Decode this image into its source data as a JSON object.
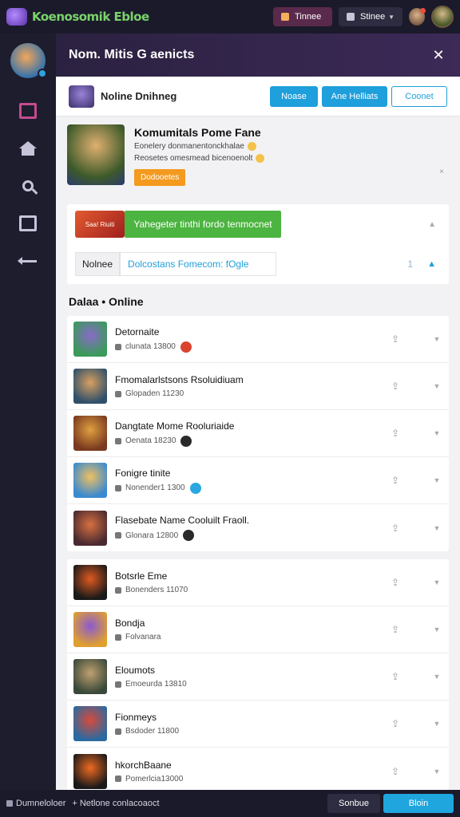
{
  "app": {
    "logo_text": "Koenosomik Ebloe",
    "top_buttons": {
      "coins_label": "Tinnee",
      "status_label": "Stinee"
    }
  },
  "sidebar": {
    "items": [
      {
        "name": "sidebar-item-library",
        "icon": "library-icon",
        "active": true
      },
      {
        "name": "sidebar-item-home",
        "icon": "home-icon",
        "active": false
      },
      {
        "name": "sidebar-item-search",
        "icon": "search-icon",
        "active": false
      },
      {
        "name": "sidebar-item-exit",
        "icon": "exit-icon",
        "active": false
      },
      {
        "name": "sidebar-item-back",
        "icon": "back-arrow-icon",
        "active": false
      }
    ]
  },
  "modal": {
    "title": "Nom. Mitis G aenicts",
    "close_glyph": "✕",
    "toolbar": {
      "label": "Noline Dnihneg",
      "buttons": [
        "Noase",
        "Ane Helliats",
        "Coonet"
      ]
    },
    "featured": {
      "title": "Komumitals Pome Fane",
      "line1": "Eonelery donmanentonckhalae",
      "line2": "Reosetes omesmead bicenoenolt",
      "tag": "Dodooetes",
      "dismiss": "×"
    },
    "actions": {
      "logo_text": "Saa! Riuiti",
      "cta_label": "Yahegeter tinthi fordo tenmocnet",
      "tab_label": "Nolnee",
      "link_label": "Dolcostans Fomecom: fOgle",
      "count": "1"
    },
    "section_title": "Dalaa • Online",
    "games": [
      {
        "name": "Detornaite",
        "sub": "clunata 13800",
        "dot": "#d9432f",
        "colors": [
          "#8a6ac8",
          "#3a9a5a"
        ]
      },
      {
        "name": "Fmomalarlstsons Rsoluidiuam",
        "sub": "Glopaden 11230",
        "dot": null,
        "colors": [
          "#d8a060",
          "#30506a"
        ]
      },
      {
        "name": "Dangtate Mome Rooluriaide",
        "sub": "Oenata 18230",
        "dot": "#2a2a2a",
        "colors": [
          "#e0a040",
          "#7a3a20"
        ]
      },
      {
        "name": "Fonigre tinite",
        "sub": "Nonender1 1300",
        "dot": "#2aa7e0",
        "colors": [
          "#f0c060",
          "#3a8ad0"
        ]
      },
      {
        "name": "Flasebate Name Cooluilt Fraoll.",
        "sub": "Glonara 12800",
        "dot": "#2a2a2a",
        "colors": [
          "#d87040",
          "#4a2a30"
        ]
      }
    ],
    "games_more": [
      {
        "name": "Botsrle Eme",
        "sub": "Bonenders 11070",
        "colors": [
          "#e05a20",
          "#1a1a1a"
        ]
      },
      {
        "name": "Bondja",
        "sub": "Folvanara",
        "colors": [
          "#8a5ad0",
          "#e0a030"
        ]
      },
      {
        "name": "Eloumots",
        "sub": "Emoeurda 13810",
        "colors": [
          "#c0a070",
          "#3a4a3a"
        ]
      },
      {
        "name": "Fionmeys",
        "sub": "Bsdoder 11800",
        "colors": [
          "#d84a3a",
          "#2a6aa0"
        ]
      },
      {
        "name": "hkorchBaane",
        "sub": "Pomerlcia13000",
        "colors": [
          "#f06a20",
          "#1a1a1a"
        ]
      }
    ]
  },
  "bottom": {
    "left_label": "Dumneloloer",
    "right_text": "+ Netlone conlacoaoct",
    "btn1": "Sonbue",
    "btn2": "Bloin"
  }
}
